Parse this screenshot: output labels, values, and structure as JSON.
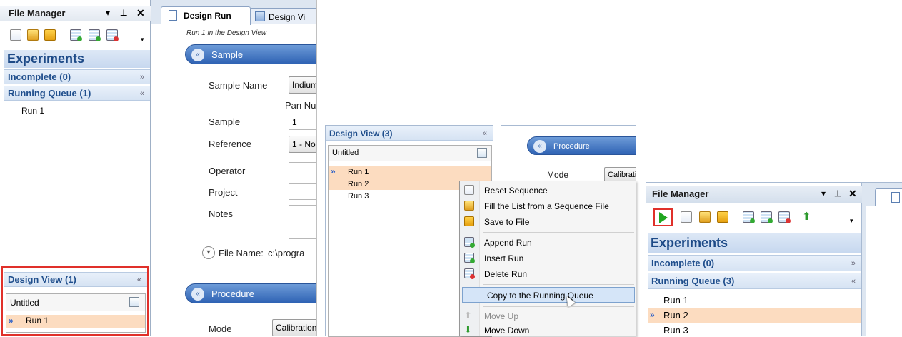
{
  "left": {
    "panel_title": "File Manager",
    "panel_controls": [
      "▾",
      "⊥",
      "✕"
    ],
    "tab_active": "Design Run",
    "tab_other": "Design Vi",
    "experiments": "Experiments",
    "incomplete": "Incomplete (0)",
    "running_queue": "Running Queue (1)",
    "queue_items": [
      "Run 1"
    ],
    "design_view": "Design View (1)",
    "list_title": "Untitled",
    "list_items": [
      "Run 1"
    ],
    "run_caption": "Run 1 in the Design View",
    "sample_section": "Sample",
    "sample_name_label": "Sample Name",
    "sample_name_value": "Indium",
    "pan_label": "Pan Nu",
    "sample_label": "Sample",
    "sample_value": "1",
    "reference_label": "Reference",
    "reference_value": "1 - No",
    "operator_label": "Operator",
    "project_label": "Project",
    "notes_label": "Notes",
    "file_name_label": "File Name:",
    "file_name_value": "c:\\progra",
    "procedure_section": "Procedure",
    "mode_label": "Mode",
    "mode_value": "Calibration"
  },
  "middle": {
    "design_view": "Design View (3)",
    "list_title": "Untitled",
    "runs": [
      "Run 1",
      "Run 2",
      "Run 3"
    ],
    "procedure_section": "Procedure",
    "mode_label": "Mode",
    "mode_value": "Calibratic",
    "menu": {
      "reset": "Reset Sequence",
      "fill": "Fill the List from a Sequence File",
      "save": "Save to File",
      "append": "Append Run",
      "insert": "Insert Run",
      "delete": "Delete Run",
      "copy": "Copy to the Running Queue",
      "move_up": "Move Up",
      "move_down": "Move Down"
    }
  },
  "right": {
    "panel_title": "File Manager",
    "panel_controls": [
      "▾",
      "⊥",
      "✕"
    ],
    "experiments": "Experiments",
    "incomplete": "Incomplete (0)",
    "running_queue": "Running Queue (3)",
    "queue_items": [
      "Run 1",
      "Run 2",
      "Run 3"
    ]
  },
  "colors": {
    "accent_blue": "#2f63b4",
    "selection": "#fcdcc0",
    "highlight_red": "#e0302a"
  }
}
